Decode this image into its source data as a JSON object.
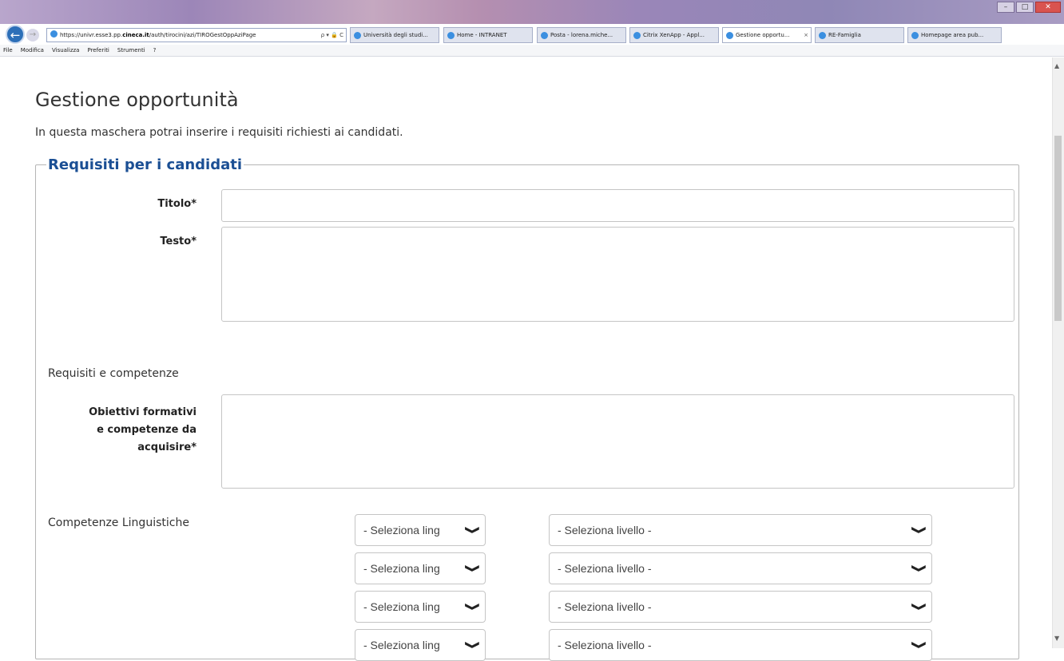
{
  "browser": {
    "address": {
      "protocol": "https://",
      "host_prefix": "univr.esse3.pp.",
      "domain": "cineca.it",
      "path": "/auth/tirocini/azi/TIROGestOppAziPage",
      "tools": "ρ ▾ 🔒 C"
    },
    "tabs": [
      {
        "label": "Università degli studi..."
      },
      {
        "label": "Home - INTRANET"
      },
      {
        "label": "Posta - lorena.miche..."
      },
      {
        "label": "Citrix XenApp - Appl..."
      },
      {
        "label": "Gestione opportu...",
        "close": "×"
      },
      {
        "label": "RE-Famiglia"
      },
      {
        "label": "Homepage area pub..."
      }
    ],
    "menu": [
      "File",
      "Modifica",
      "Visualizza",
      "Preferiti",
      "Strumenti",
      "?"
    ]
  },
  "page": {
    "title": "Gestione opportunità",
    "intro": "In questa maschera potrai inserire i requisiti richiesti ai candidati.",
    "fieldset_legend": "Requisiti per i candidati",
    "fields": {
      "titolo_label": "Titolo*",
      "testo_label": "Testo*",
      "requisiti_section": "Requisiti e competenze",
      "obiettivi_label_1": "Obiettivi formativi",
      "obiettivi_label_2": "e competenze da",
      "obiettivi_label_3": "acquisire*",
      "lingue_section": "Competenze Linguistiche"
    },
    "language_rows": [
      {
        "lang_placeholder": "- Seleziona ling",
        "level_placeholder": "- Seleziona livello -"
      },
      {
        "lang_placeholder": "- Seleziona ling",
        "level_placeholder": "- Seleziona livello -"
      },
      {
        "lang_placeholder": "- Seleziona ling",
        "level_placeholder": "- Seleziona livello -"
      },
      {
        "lang_placeholder": "- Seleziona ling",
        "level_placeholder": "- Seleziona livello -"
      }
    ]
  },
  "colors": {
    "legend": "#1b4f94",
    "titlebar": "#9c86b8",
    "field_border": "#c5c5c5"
  }
}
